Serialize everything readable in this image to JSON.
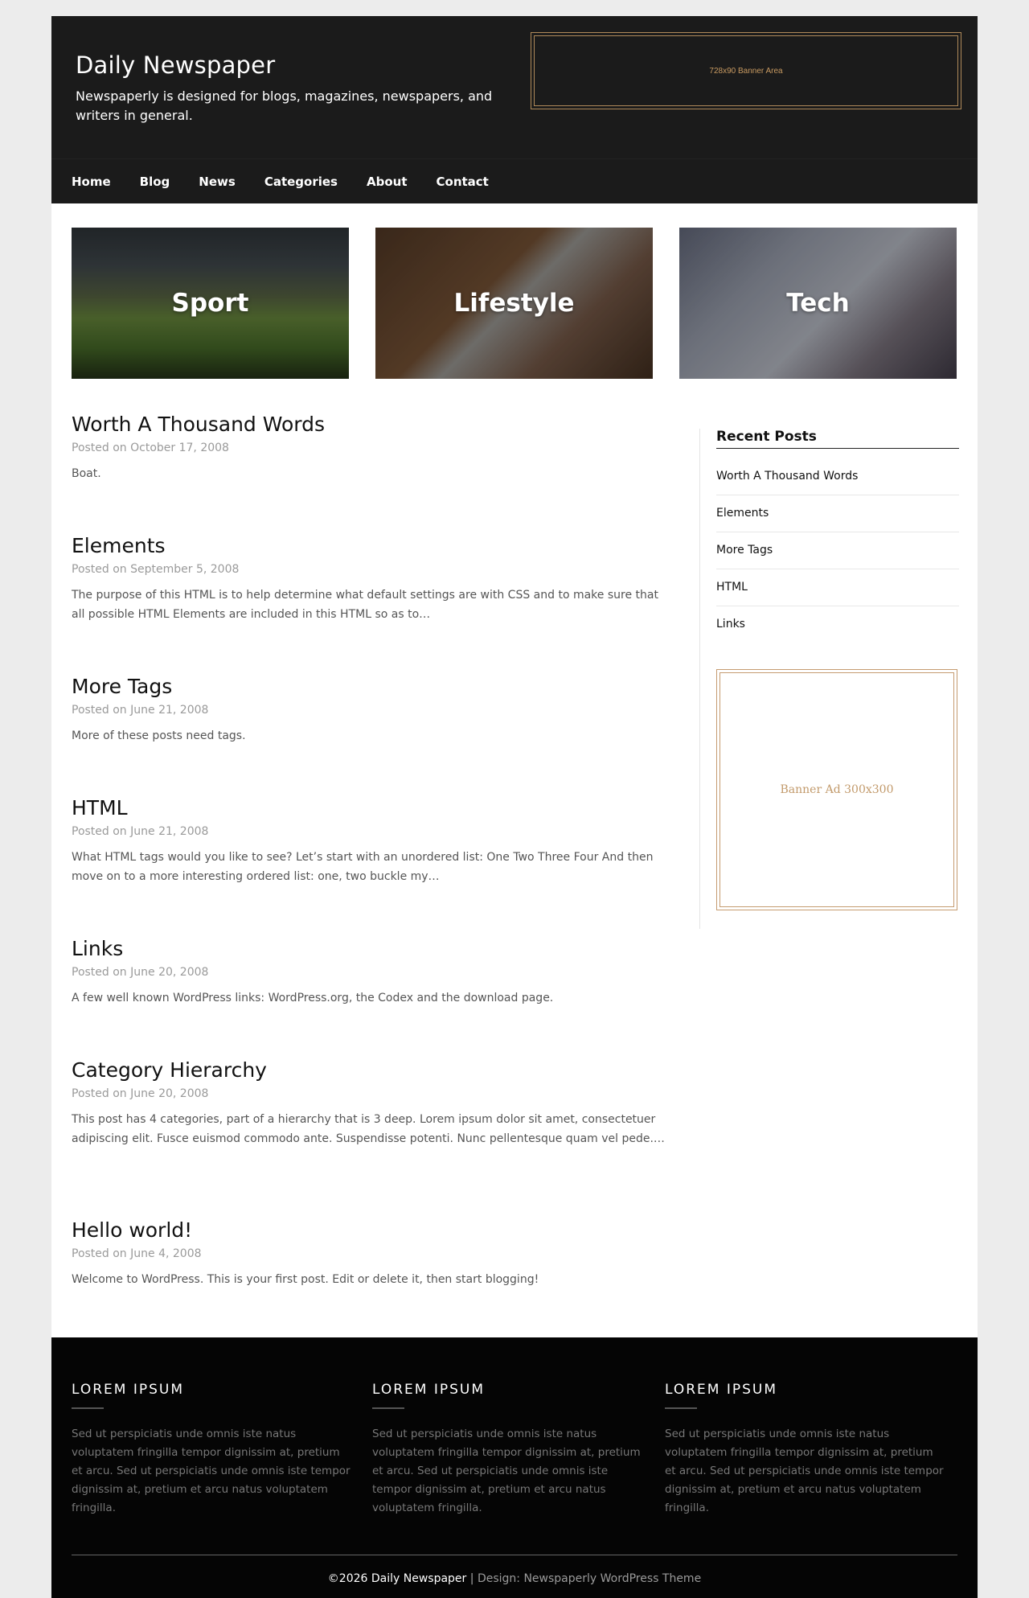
{
  "site": {
    "title": "Daily Newspaper",
    "description": "Newspaperly is designed for blogs, magazines, newspapers, and writers in general.",
    "banner_top": "728x90 Banner Area"
  },
  "nav": [
    "Home",
    "Blog",
    "News",
    "Categories",
    "About",
    "Contact"
  ],
  "categories": [
    {
      "label": "Sport"
    },
    {
      "label": "Lifestyle"
    },
    {
      "label": "Tech"
    }
  ],
  "posts": [
    {
      "title": "Worth A Thousand Words",
      "meta": "Posted on October 17, 2008",
      "excerpt": "Boat."
    },
    {
      "title": "Elements",
      "meta": "Posted on September 5, 2008",
      "excerpt": "The purpose of this HTML is to help determine what default settings are with CSS and to make sure that all possible HTML Elements are included in this HTML so as to…"
    },
    {
      "title": "More Tags",
      "meta": "Posted on June 21, 2008",
      "excerpt": "More of these posts need tags."
    },
    {
      "title": "HTML",
      "meta": "Posted on June 21, 2008",
      "excerpt": "What HTML tags would you like to see? Let’s start with an unordered list: One Two Three Four And then move on to a more interesting ordered list: one, two buckle my…"
    },
    {
      "title": "Links",
      "meta": "Posted on June 20, 2008",
      "excerpt": "A few well known WordPress links: WordPress.org, the Codex and the download page."
    },
    {
      "title": "Category Hierarchy",
      "meta": "Posted on June 20, 2008",
      "excerpt": "This post has 4 categories, part of a hierarchy that is 3 deep. Lorem ipsum dolor sit amet, consectetuer adipiscing elit. Fusce euismod commodo ante. Suspendisse potenti. Nunc pellentesque quam vel pede.…"
    },
    {
      "title": "Hello world!",
      "meta": "Posted on June 4, 2008",
      "excerpt": "Welcome to WordPress. This is your first post. Edit or delete it, then start blogging!"
    }
  ],
  "sidebar": {
    "recent_title": "Recent Posts",
    "recent": [
      "Worth A Thousand Words",
      "Elements",
      "More Tags",
      "HTML",
      "Links"
    ],
    "ad": "Banner Ad 300x300"
  },
  "footer": {
    "cols": [
      {
        "title": "LOREM IPSUM",
        "text": "Sed ut perspiciatis unde omnis iste natus voluptatem fringilla tempor dignissim at, pretium et arcu. Sed ut perspiciatis unde omnis iste tempor dignissim at, pretium et arcu natus voluptatem fringilla."
      },
      {
        "title": "LOREM IPSUM",
        "text": "Sed ut perspiciatis unde omnis iste natus voluptatem fringilla tempor dignissim at, pretium et arcu. Sed ut perspiciatis unde omnis iste tempor dignissim at, pretium et arcu natus voluptatem fringilla."
      },
      {
        "title": "LOREM IPSUM",
        "text": "Sed ut perspiciatis unde omnis iste natus voluptatem fringilla tempor dignissim at, pretium et arcu. Sed ut perspiciatis unde omnis iste tempor dignissim at, pretium et arcu natus voluptatem fringilla."
      }
    ],
    "copyright": "©2026 Daily Newspaper",
    "separator": "|",
    "design": "Design: Newspaperly WordPress Theme"
  }
}
